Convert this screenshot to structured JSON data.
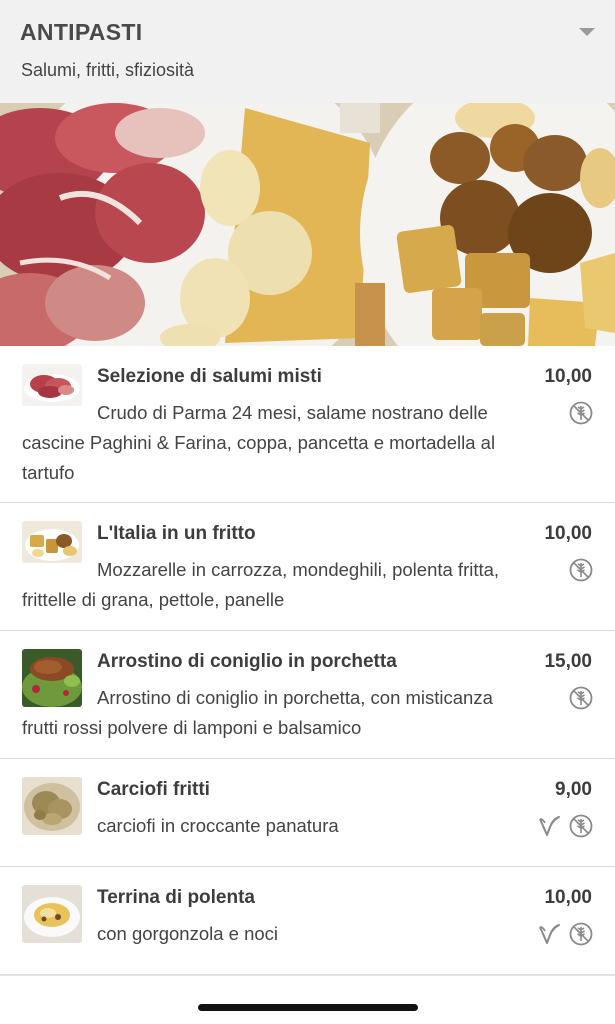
{
  "section": {
    "title": "ANTIPASTI",
    "subtitle": "Salumi, fritti, sfiziosità"
  },
  "items": [
    {
      "name": "Selezione di salumi misti",
      "price": "10,00",
      "description": "Crudo di Parma 24 mesi, salame nostrano delle cascine Paghini & Farina, coppa, pancetta e mortadella al tartufo",
      "badges": [
        "no-gluten-free-icon"
      ]
    },
    {
      "name": "L'Italia in un fritto",
      "price": "10,00",
      "description": "Mozzarelle in carrozza, mondeghili, polenta fritta, frittelle di grana, pettole, panelle",
      "badges": [
        "no-gluten-free-icon"
      ]
    },
    {
      "name": "Arrostino di coniglio in porchetta",
      "price": "15,00",
      "description": "Arrostino di coniglio in porchetta, con misticanza frutti rossi polvere di lamponi e balsamico",
      "badges": [
        "no-gluten-free-icon"
      ]
    },
    {
      "name": "Carciofi fritti",
      "price": "9,00",
      "description": "carciofi in croccante panatura",
      "badges": [
        "vegetarian-icon",
        "no-gluten-free-icon"
      ]
    },
    {
      "name": "Terrina di polenta",
      "price": "10,00",
      "description": "con gorgonzola e noci",
      "badges": [
        "vegetarian-icon",
        "no-gluten-free-icon"
      ]
    }
  ],
  "colors": {
    "header_bg": "#f1f1f1",
    "text": "#3d3d3d",
    "icon": "#8a8a8a"
  }
}
